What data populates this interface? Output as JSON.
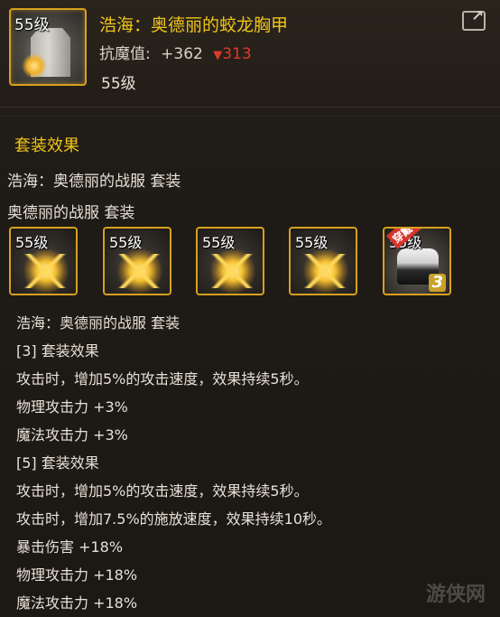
{
  "item": {
    "level_badge": "55级",
    "title": "浩海：奥德丽的蛟龙胸甲",
    "stat_label": "抗魔值:",
    "stat_value": "+362",
    "stat_change": "313",
    "level_text": "55级"
  },
  "header": {
    "share_icon": "share-icon"
  },
  "set": {
    "section_title": "套装效果",
    "line1": "浩海：奥德丽的战服 套装",
    "line2": "奥德丽的战服 套装",
    "slots": [
      {
        "level": "55级",
        "icon": "coat-icon"
      },
      {
        "level": "55级",
        "icon": "coat-icon"
      },
      {
        "level": "55级",
        "icon": "coat-icon"
      },
      {
        "level": "55级",
        "icon": "coat-icon"
      },
      {
        "level": "55级",
        "icon": "boot-icon",
        "badge": "穿戴中",
        "count": "3"
      }
    ],
    "effects": [
      "浩海：奥德丽的战服 套装",
      "[3] 套装效果",
      "攻击时，增加5%的攻击速度，效果持续5秒。",
      "物理攻击力 +3%",
      "魔法攻击力 +3%",
      "[5] 套装效果",
      "攻击时，增加5%的攻击速度，效果持续5秒。",
      "攻击时，增加7.5%的施放速度，效果持续10秒。",
      "暴击伤害 +18%",
      "物理攻击力 +18%",
      "魔法攻击力 +18%"
    ]
  },
  "watermark": "游侠网",
  "colors": {
    "gold": "#f0c419",
    "down": "#e03a2a",
    "frame": "#d8a020"
  }
}
